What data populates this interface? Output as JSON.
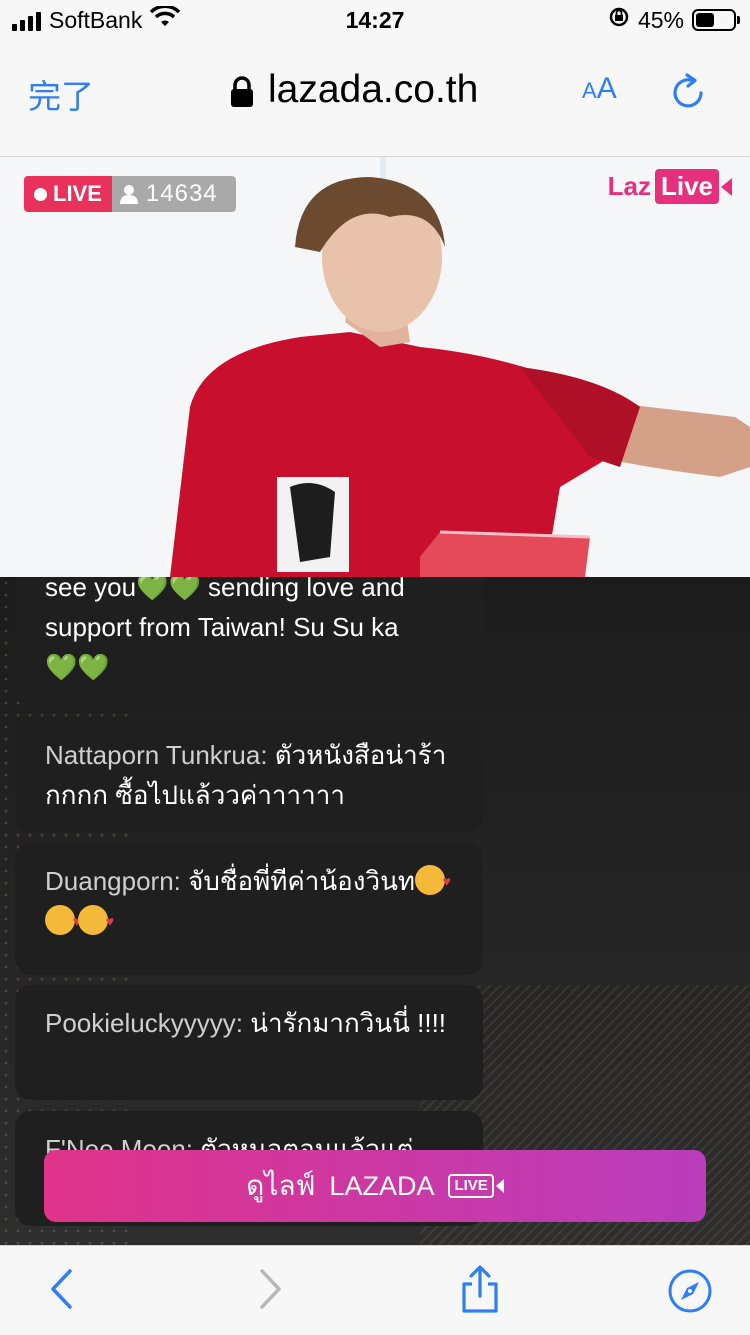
{
  "status_bar": {
    "carrier": "SoftBank",
    "time": "14:27",
    "battery_percent": "45%",
    "battery_level": 0.45
  },
  "browser": {
    "done_label": "完了",
    "url": "lazada.co.th",
    "text_size_label_small": "A",
    "text_size_label_large": "A"
  },
  "video": {
    "live_label": "LIVE",
    "viewer_count": "14634",
    "logo_text_laz": "Laz",
    "logo_text_live": "Live"
  },
  "chat": {
    "messages": [
      {
        "name": "",
        "text_line1": "see you",
        "text_hearts1": "💚💚",
        "text_line1b": " sending love and",
        "text_line2": "support from Taiwan! Su Su ka",
        "text_hearts2": "💚💚"
      },
      {
        "name": "Nattaporn Tunkrua:",
        "text": " ตัวหนังสือน่าร้ากกกก ซื้อไปแล้ววค่าาาาาา"
      },
      {
        "name": "Duangporn:",
        "text": " จับชื่อพี่ทีค่าน้องวินท"
      },
      {
        "name": "Pookieluckyyyyy:",
        "text": " น่ารักมากวินนี่ !!!!"
      },
      {
        "name": "F'Nee Moon:",
        "text": " ตัวหนอตอนแล้วแต่"
      }
    ]
  },
  "cta": {
    "label_th": "ดูไลฟ์",
    "label_brand": "LAZADA",
    "label_live": "LIVE"
  },
  "colors": {
    "ios_blue": "#2f7ef5",
    "live_red": "#e8325b",
    "laz_pink": "#e6307e",
    "cta_start": "#e0338a",
    "cta_end": "#b93dbd"
  },
  "icons": [
    "signal-icon",
    "wifi-icon",
    "orientation-lock-icon",
    "battery-icon",
    "lock-icon",
    "reload-icon",
    "user-icon",
    "back-icon",
    "forward-icon",
    "share-icon",
    "compass-icon"
  ]
}
